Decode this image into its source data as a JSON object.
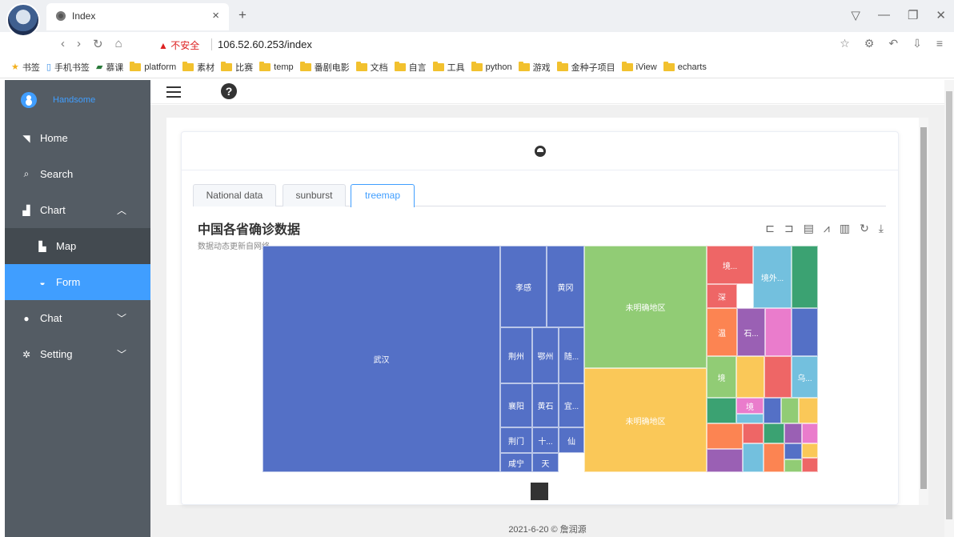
{
  "browser": {
    "tab_title": "Index",
    "tab_close": "×",
    "new_tab": "+",
    "insecure_label": "▲ 不安全",
    "url": "106.52.60.253/index",
    "bookmarks": [
      "书签",
      "手机书签",
      "慕课",
      "platform",
      "素材",
      "比赛",
      "temp",
      "番剧电影",
      "文档",
      "自言",
      "工具",
      "python",
      "游戏",
      "金种子项目",
      "iView",
      "echarts"
    ]
  },
  "sidebar": {
    "user_name": "Handsome",
    "items": [
      {
        "label": "Home",
        "icon": "home-icon"
      },
      {
        "label": "Search",
        "icon": "search-icon"
      },
      {
        "label": "Chart",
        "icon": "chart-icon"
      },
      {
        "label": "Map",
        "icon": "map-icon"
      },
      {
        "label": "Form",
        "icon": "form-icon"
      },
      {
        "label": "Chat",
        "icon": "chat-icon"
      },
      {
        "label": "Setting",
        "icon": "gear-icon"
      }
    ]
  },
  "tabs": [
    "National data",
    "sunburst",
    "treemap"
  ],
  "chart": {
    "title": "中国各省确诊数据",
    "subtitle": "数据动态更新自网络"
  },
  "footer": "2021-6-20 © 詹润源",
  "chart_data": {
    "type": "treemap",
    "title": "中国各省确诊数据",
    "subtitle": "数据动态更新自网络",
    "nodes": [
      {
        "label": "武汉",
        "color": "#5470c6"
      },
      {
        "label": "孝感",
        "color": "#5470c6"
      },
      {
        "label": "黄冈",
        "color": "#5470c6"
      },
      {
        "label": "荆州",
        "color": "#5470c6"
      },
      {
        "label": "鄂州",
        "color": "#5470c6"
      },
      {
        "label": "随...",
        "color": "#5470c6"
      },
      {
        "label": "襄阳",
        "color": "#5470c6"
      },
      {
        "label": "黄石",
        "color": "#5470c6"
      },
      {
        "label": "宜...",
        "color": "#5470c6"
      },
      {
        "label": "荆门",
        "color": "#5470c6"
      },
      {
        "label": "十...",
        "color": "#5470c6"
      },
      {
        "label": "仙",
        "color": "#5470c6"
      },
      {
        "label": "咸宁",
        "color": "#5470c6"
      },
      {
        "label": "天",
        "color": "#5470c6"
      },
      {
        "label": "未明确地区",
        "color": "#91cc75"
      },
      {
        "label": "未明确地区",
        "color": "#fac858"
      },
      {
        "label": "境...",
        "color": "#ee6666"
      },
      {
        "label": "境外...",
        "color": "#73c0de"
      },
      {
        "label": "深",
        "color": "#ee6666"
      },
      {
        "label": "温",
        "color": "#fc8452"
      },
      {
        "label": "石...",
        "color": "#9a60b4"
      },
      {
        "label": "境",
        "color": "#91cc75"
      },
      {
        "label": "乌...",
        "color": "#73c0de"
      },
      {
        "label": "境",
        "color": "#ea7ccc"
      }
    ]
  }
}
